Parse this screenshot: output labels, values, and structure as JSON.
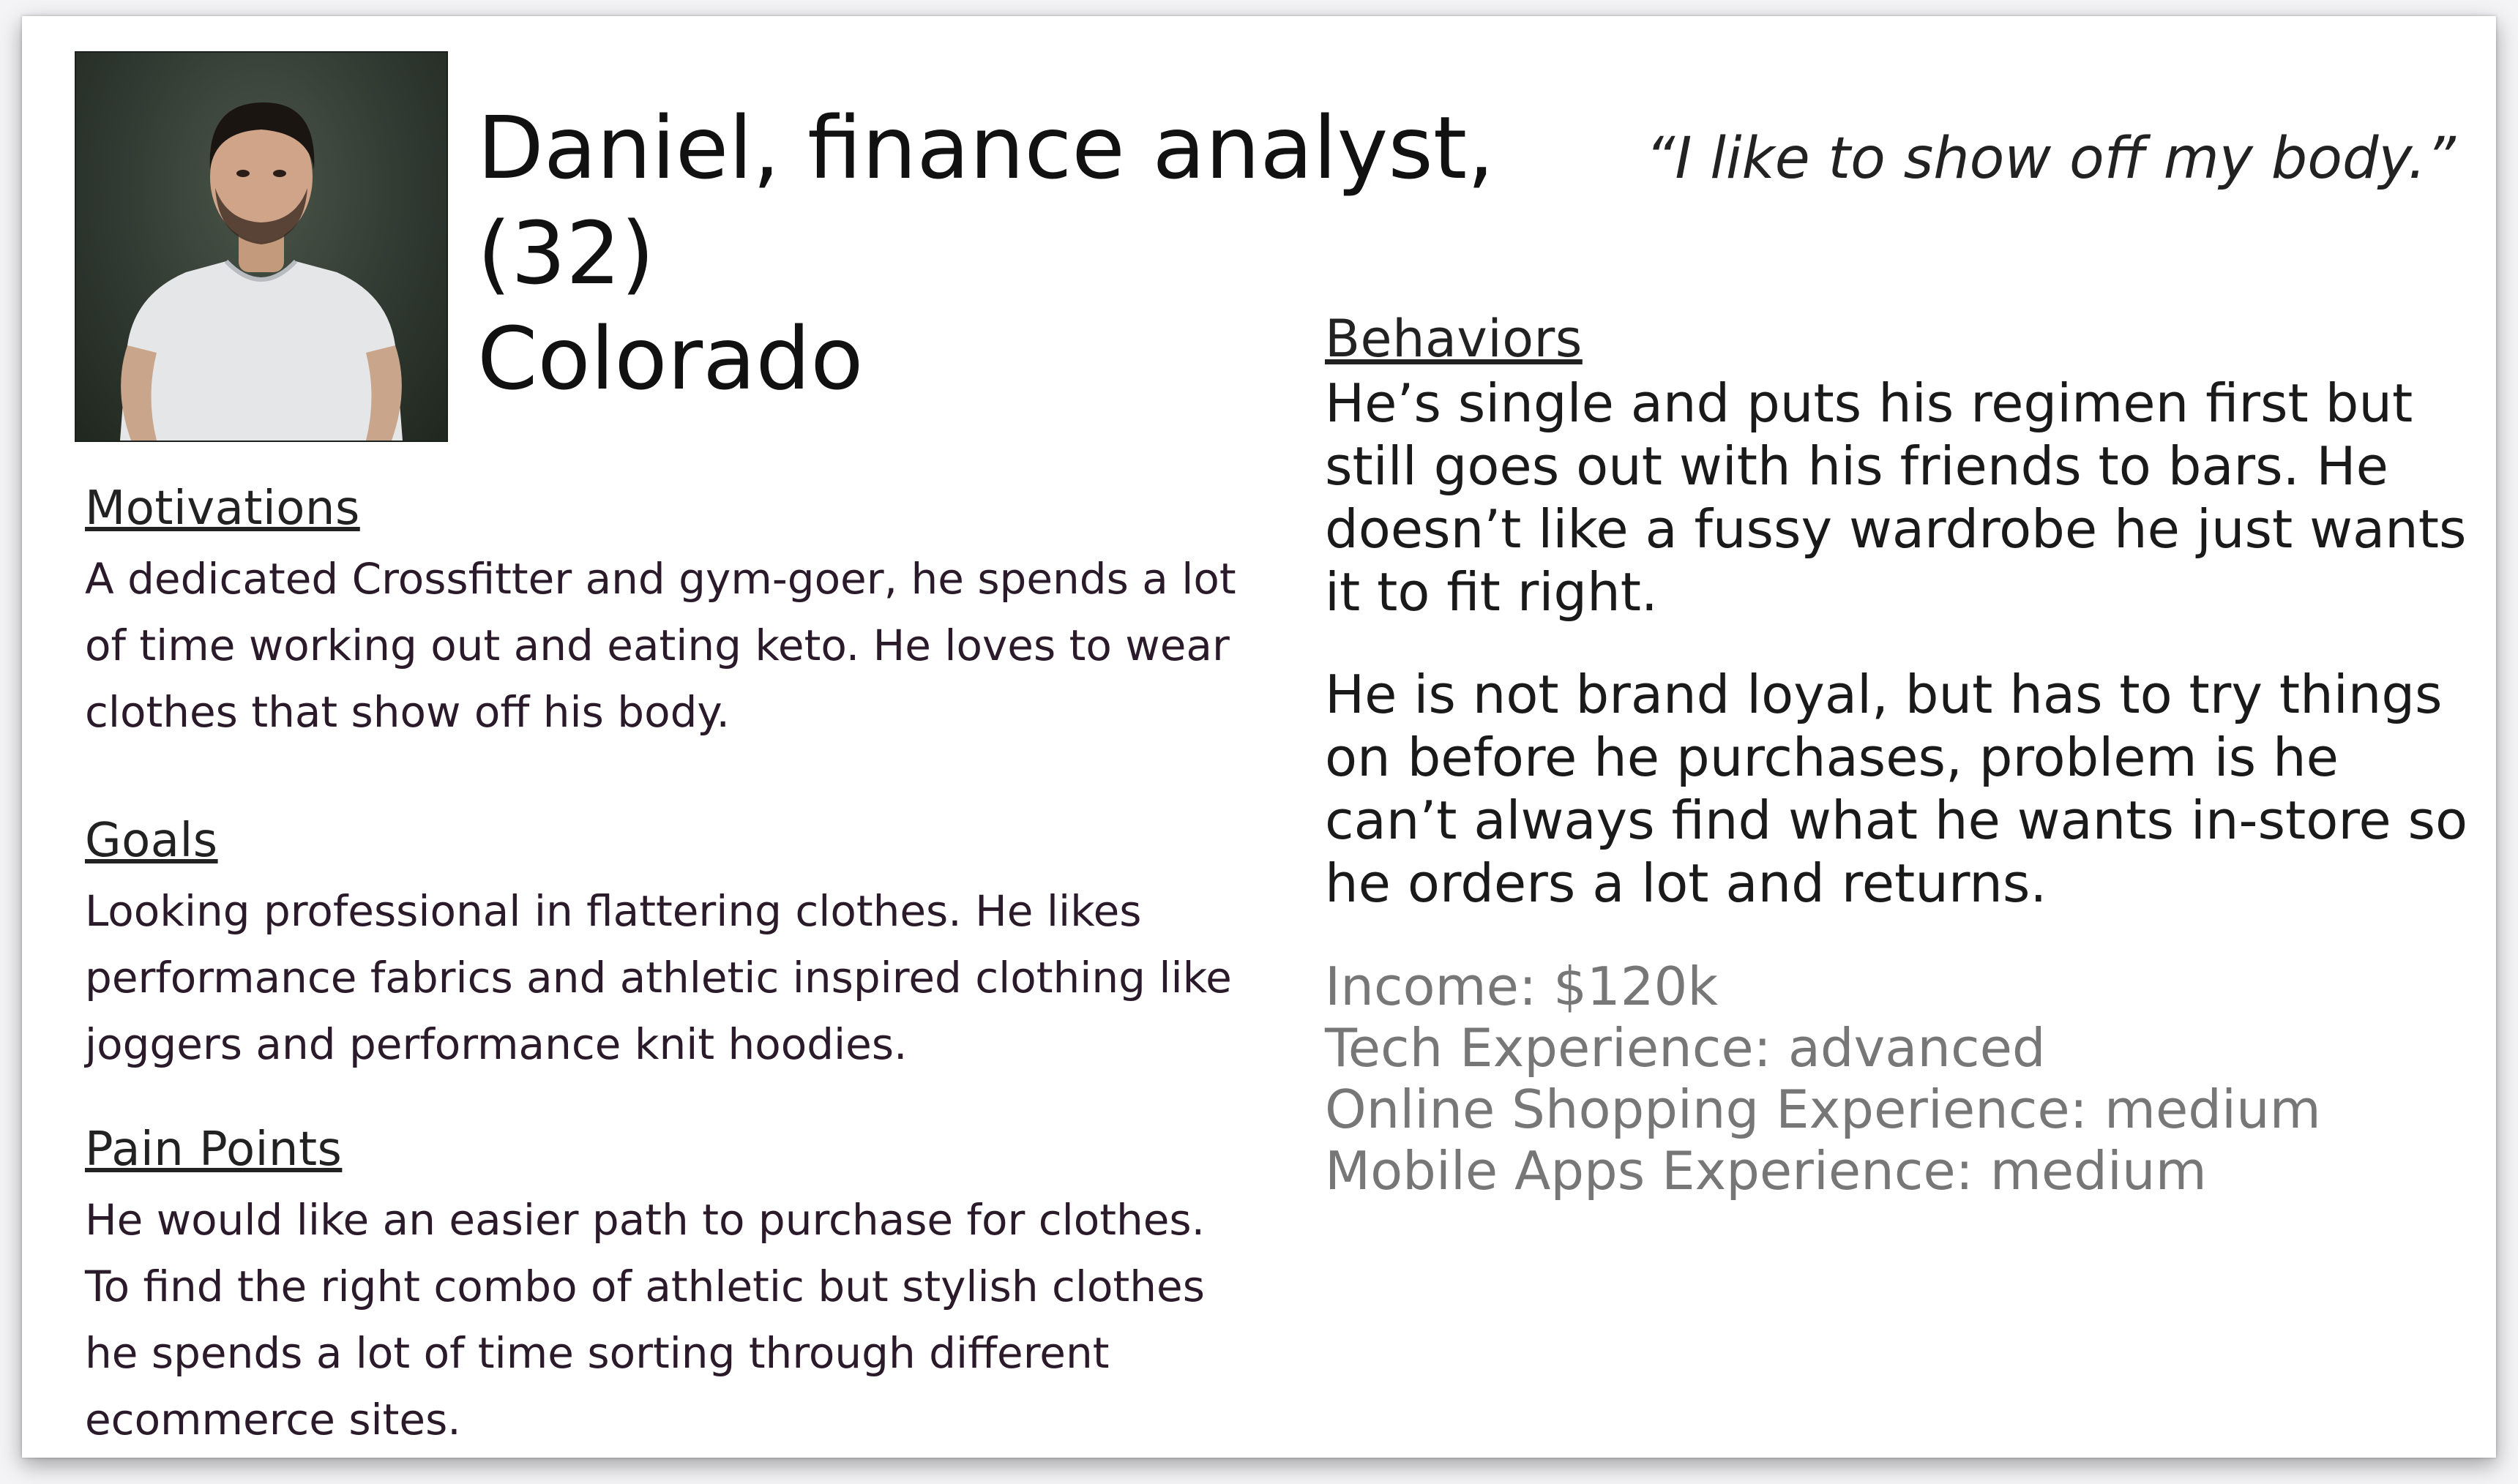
{
  "persona": {
    "title_line1": "Daniel, finance analyst, (32)",
    "title_line2": "Colorado",
    "quote": "“I like to show off my body.”"
  },
  "motivations": {
    "heading": "Motivations",
    "text": "A dedicated Crossfitter and gym-goer, he spends a lot of time working out and eating keto. He loves to wear clothes that show off his body."
  },
  "goals": {
    "heading": "Goals",
    "text": "Looking professional in flattering clothes. He likes performance fabrics and athletic inspired clothing like joggers and performance knit hoodies."
  },
  "pain_points": {
    "heading": "Pain Points",
    "text": "He would like an easier path to purchase for clothes. To find the right combo of athletic but stylish clothes he spends a lot of time sorting through different ecommerce sites."
  },
  "behaviors": {
    "heading": "Behaviors",
    "paragraph1": "He’s single and puts his regimen first but still goes out with his friends to bars. He doesn’t like a fussy wardrobe he just wants it to fit right.",
    "paragraph2": "He is not brand loyal, but has to try things on before he purchases, problem is he can’t always find what he wants in-store so he orders a lot and returns."
  },
  "stats": {
    "income": "Income: $120k",
    "tech": "Tech Experience: advanced",
    "shopping": "Online Shopping Experience: medium",
    "mobile": "Mobile Apps Experience: medium"
  }
}
